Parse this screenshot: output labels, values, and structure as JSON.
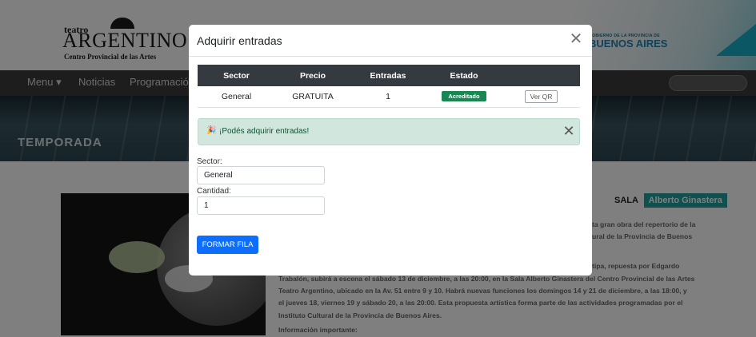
{
  "site": {
    "logo_small": "teatro",
    "logo_big": "ARGENTINO",
    "logo_sub": "Centro Provincial de las Artes",
    "gov_small": "GOBIERNO DE LA PROVINCIA DE",
    "gov_big": "BUENOS AIRES",
    "nav": [
      "Menu ▾",
      "Noticias",
      "Programación"
    ],
    "banner_title": "TEMPORADA",
    "sala_label": "SALA",
    "sala_name": "Alberto Ginastera",
    "right_lines": [
      "ta gran obra del repertorio de la",
      "ural de la Provincia de Buenos",
      "tipa, repuesta por Edgardo"
    ],
    "article_lines": [
      "Trabalón, subirá a escena el sábado 13 de diciembre, a las 20:00, en la Sala Alberto Ginastera del Centro Provincial de las Artes",
      "Teatro Argentino, ubicado en la Av. 51 entre 9 y 10. Habrá nuevas funciones los domingos 14 y 21 de diciembre, a las 18:00, y",
      "el jueves 18, viernes 19 y sábado 20, a las 20:00. Esta propuesta artística  forma parte de las actividades programadas por el",
      "Instituto Cultural de la Provincia de Buenos Aires."
    ],
    "info_title": "Información importante:"
  },
  "modal": {
    "title": "Adquirir entradas",
    "close_glyph": "✕",
    "table": {
      "headers": [
        "Sector",
        "Precio",
        "Entradas",
        "Estado",
        ""
      ],
      "rows": [
        {
          "sector": "General",
          "precio": "GRATUITA",
          "entradas": "1",
          "estado": "Acreditado",
          "action": "Ver QR"
        }
      ]
    },
    "alert": {
      "icon": "🎉",
      "text": "¡Podés adquirir entradas!",
      "close_glyph": "✕"
    },
    "form": {
      "sector_label": "Sector:",
      "sector_value": "General",
      "cantidad_label": "Cantidad:",
      "cantidad_value": "1",
      "submit_label": "FORMAR FILA"
    }
  },
  "colors": {
    "table_header": "#343a40",
    "badge_success": "#198754",
    "alert_bg": "#d1e7dd",
    "primary": "#0d6efd",
    "sala_tag": "#21a19c"
  }
}
